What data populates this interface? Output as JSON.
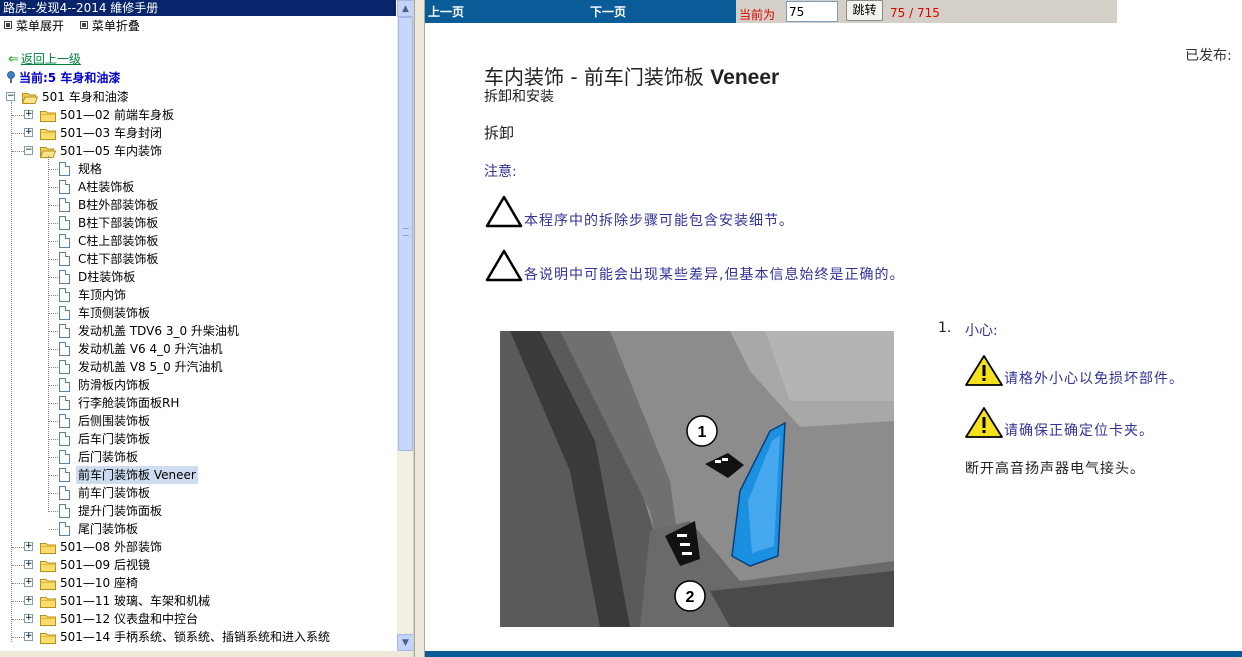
{
  "app": {
    "title": "路虎--发现4--2014 維修手册"
  },
  "menu": {
    "expand_label": "菜单展开",
    "collapse_label": "菜单折叠"
  },
  "nav": {
    "back_label": "返回上一级",
    "current_label": "当前:5 车身和油漆"
  },
  "tree": {
    "root": "501 车身和油漆",
    "items": [
      {
        "label": "501—02 前端车身板",
        "kind": "folder",
        "expanded": false
      },
      {
        "label": "501—03 车身封闭",
        "kind": "folder",
        "expanded": false
      },
      {
        "label": "501—05 车内装饰",
        "kind": "folder",
        "expanded": true
      },
      {
        "label": "规格",
        "kind": "doc"
      },
      {
        "label": "A柱装饰板",
        "kind": "doc"
      },
      {
        "label": "B柱外部装饰板",
        "kind": "doc"
      },
      {
        "label": "B柱下部装饰板",
        "kind": "doc"
      },
      {
        "label": "C柱上部装饰板",
        "kind": "doc"
      },
      {
        "label": "C柱下部装饰板",
        "kind": "doc"
      },
      {
        "label": "D柱装饰板",
        "kind": "doc"
      },
      {
        "label": "车顶内饰",
        "kind": "doc"
      },
      {
        "label": "车顶侧装饰板",
        "kind": "doc"
      },
      {
        "label": "发动机盖  TDV6 3_0 升柴油机",
        "kind": "doc"
      },
      {
        "label": "发动机盖  V6 4_0 升汽油机",
        "kind": "doc"
      },
      {
        "label": "发动机盖  V8 5_0 升汽油机",
        "kind": "doc"
      },
      {
        "label": "防滑板内饰板",
        "kind": "doc"
      },
      {
        "label": "行李舱装饰面板RH",
        "kind": "doc"
      },
      {
        "label": "后侧围装饰板",
        "kind": "doc"
      },
      {
        "label": "后车门装饰板",
        "kind": "doc"
      },
      {
        "label": "后门装饰板",
        "kind": "doc"
      },
      {
        "label": "前车门装饰板  Veneer",
        "kind": "doc",
        "selected": true
      },
      {
        "label": "前车门装饰板",
        "kind": "doc"
      },
      {
        "label": "提升门装饰面板",
        "kind": "doc"
      },
      {
        "label": "尾门装饰板",
        "kind": "doc"
      },
      {
        "label": "501—08 外部装饰",
        "kind": "folder",
        "expanded": false
      },
      {
        "label": "501—09 后视镜",
        "kind": "folder",
        "expanded": false
      },
      {
        "label": "501—10 座椅",
        "kind": "folder",
        "expanded": false
      },
      {
        "label": "501—11 玻璃、车架和机械",
        "kind": "folder",
        "expanded": false
      },
      {
        "label": "501—12 仪表盘和中控台",
        "kind": "folder",
        "expanded": false
      },
      {
        "label": "501—14 手柄系统、锁系统、插销系统和进入系统",
        "kind": "folder",
        "expanded": false
      }
    ]
  },
  "toolbar": {
    "prev_label": "上一页",
    "next_label": "下一页",
    "current_page_label": "当前为",
    "page_value": "75",
    "jump_label": "跳转",
    "page_count": "75 / 715"
  },
  "content": {
    "published_label": "已发布:",
    "title_cn": "车内装饰 - 前车门装饰板 ",
    "title_en": "Veneer",
    "subtitle": "拆卸和安装",
    "removal": "拆卸",
    "note_label": "注意:",
    "notes": [
      "本程序中的拆除步骤可能包含安装细节。",
      "各说明中可能会出现某些差异,但基本信息始终是正确的。"
    ],
    "step": {
      "number": "1.",
      "caution_label": "小心:",
      "warnings": [
        "请格外小心以免损坏部件。",
        "请确保正确定位卡夹。"
      ],
      "text": "断开高音扬声器电气接头。"
    },
    "figure_callouts": [
      "1",
      "2"
    ]
  },
  "colors": {
    "titlebar": "#08246b",
    "toolbar": "#0a5c98",
    "note_text": "#333399",
    "page_red": "#e00000",
    "selection": "#cfdcf0"
  }
}
